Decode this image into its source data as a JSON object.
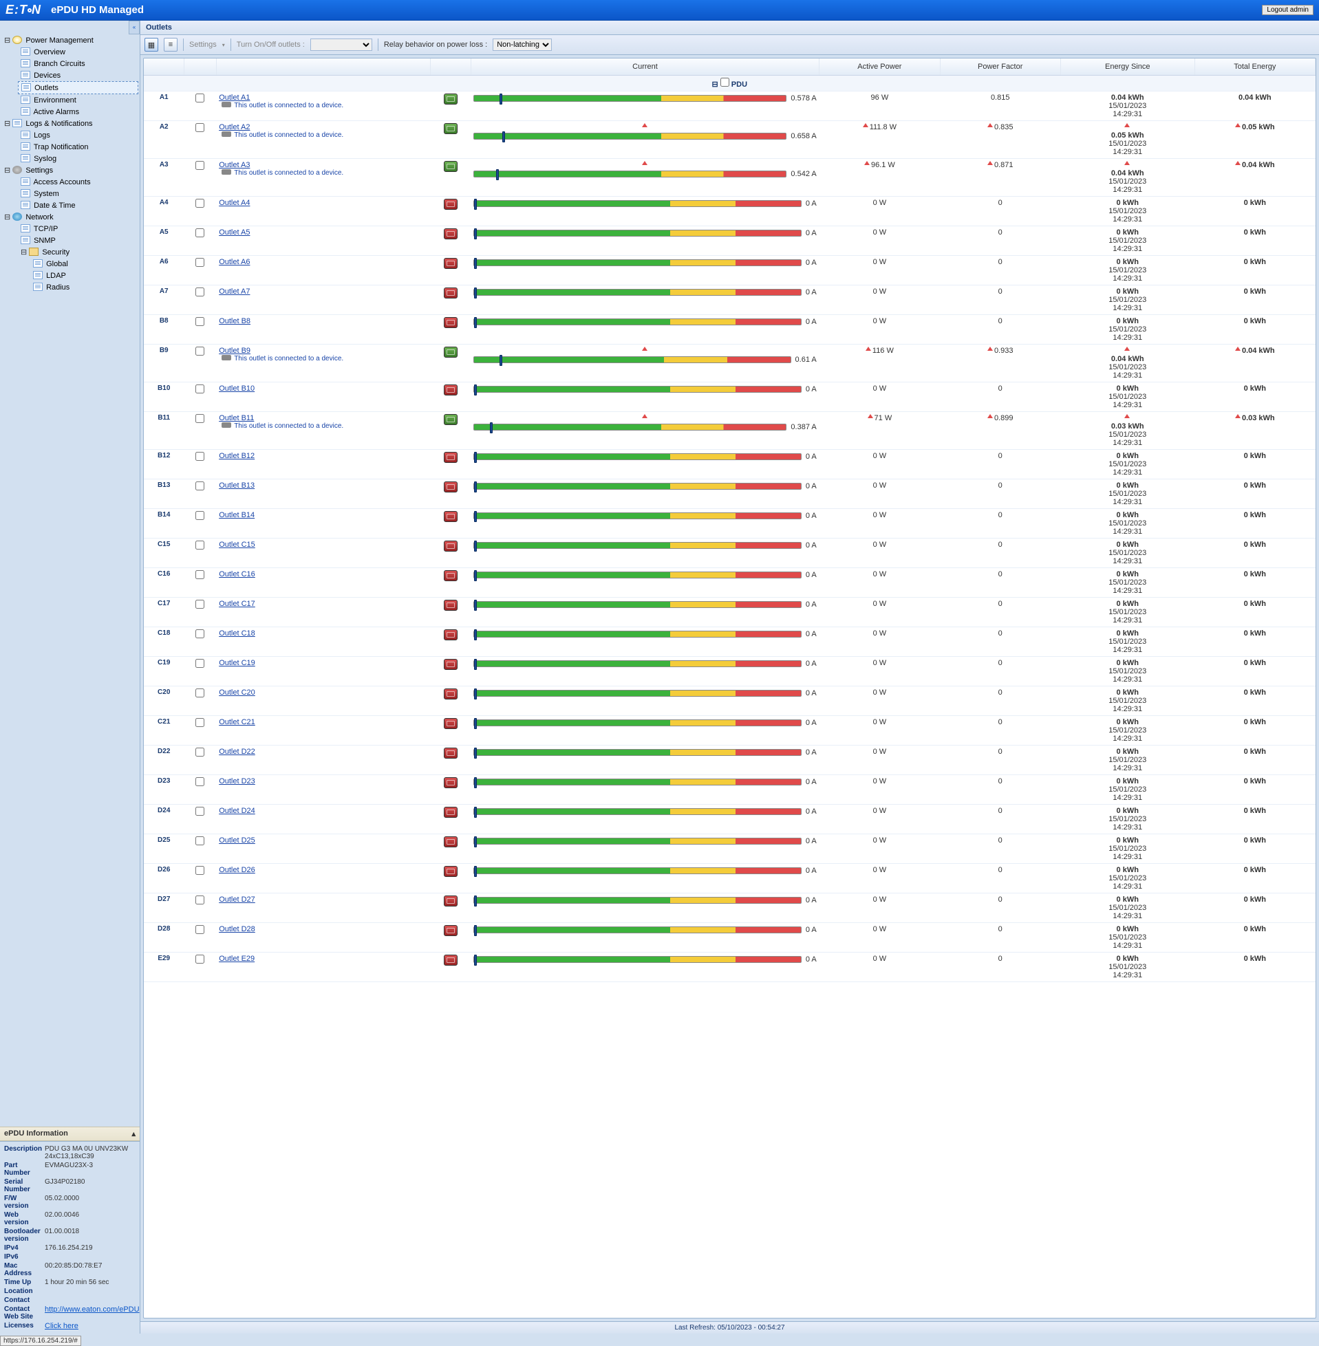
{
  "header": {
    "brand": "E•T•N",
    "product": "ePDU HD Managed",
    "logout": "Logout admin"
  },
  "nav": {
    "top": "Power Management",
    "items1": [
      "Overview",
      "Branch Circuits",
      "Devices",
      "Outlets",
      "Environment",
      "Active Alarms"
    ],
    "selected": "Outlets",
    "group2": "Logs & Notifications",
    "items2": [
      "Logs",
      "Trap Notification",
      "Syslog"
    ],
    "group3": "Settings",
    "items3": [
      "Access Accounts",
      "System",
      "Date & Time"
    ],
    "group4": "Network",
    "items4": [
      "TCP/IP",
      "SNMP"
    ],
    "sec": "Security",
    "items4b": [
      "Global",
      "LDAP",
      "Radius"
    ]
  },
  "meta": {
    "title": "ePDU Information",
    "rows": [
      [
        "Description",
        "PDU G3 MA 0U UNV23KW 24xC13,18xC39"
      ],
      [
        "Part Number",
        "EVMAGU23X-3"
      ],
      [
        "Serial Number",
        "GJ34P02180"
      ],
      [
        "F/W version",
        "05.02.0000"
      ],
      [
        "Web version",
        "02.00.0046"
      ],
      [
        "Bootloader version",
        "01.00.0018"
      ],
      [
        "IPv4",
        "176.16.254.219"
      ],
      [
        "IPv6",
        ""
      ],
      [
        "Mac Address",
        "00:20:85:D0:78:E7"
      ],
      [
        "Time Up",
        "1 hour 20 min 56 sec"
      ],
      [
        "Location",
        ""
      ],
      [
        "Contact",
        ""
      ]
    ],
    "website_lbl": "Contact Web Site",
    "website": "http://www.eaton.com/ePDU",
    "lic_lbl": "Licenses",
    "lic": "Click here"
  },
  "page": {
    "title": "Outlets"
  },
  "toolbar": {
    "settings": "Settings",
    "turn": "Turn On/Off outlets :",
    "relay": "Relay behavior on power loss :",
    "relay_val": "Non-latching"
  },
  "cols": {
    "c1": "",
    "c2": "",
    "c3": "",
    "c4": "",
    "cur": "Current",
    "ap": "Active Power",
    "pf": "Power Factor",
    "es": "Energy Since",
    "te": "Total Energy"
  },
  "group": "PDU",
  "conn_msg": "This outlet is connected to a device.",
  "ts": "15/01/2023 14:29:31",
  "outlets": [
    {
      "id": "A1",
      "name": "Outlet A1",
      "on": true,
      "conn": true,
      "pos": 8,
      "cur": "0.578 A",
      "ap": "96 W",
      "pf": "0.815",
      "es": "0.04 kWh",
      "te": "0.04 kWh",
      "tri": false
    },
    {
      "id": "A2",
      "name": "Outlet A2",
      "on": true,
      "conn": true,
      "pos": 9,
      "cur": "0.658 A",
      "ap": "111.8 W",
      "pf": "0.835",
      "es": "0.05 kWh",
      "te": "0.05 kWh",
      "tri": true
    },
    {
      "id": "A3",
      "name": "Outlet A3",
      "on": true,
      "conn": true,
      "pos": 7,
      "cur": "0.542 A",
      "ap": "96.1 W",
      "pf": "0.871",
      "es": "0.04 kWh",
      "te": "0.04 kWh",
      "tri": true
    },
    {
      "id": "A4",
      "name": "Outlet A4",
      "on": false,
      "conn": false,
      "pos": 0,
      "cur": "0 A",
      "ap": "0 W",
      "pf": "0",
      "es": "0 kWh",
      "te": "0 kWh",
      "tri": false
    },
    {
      "id": "A5",
      "name": "Outlet A5",
      "on": false,
      "conn": false,
      "pos": 0,
      "cur": "0 A",
      "ap": "0 W",
      "pf": "0",
      "es": "0 kWh",
      "te": "0 kWh",
      "tri": false
    },
    {
      "id": "A6",
      "name": "Outlet A6",
      "on": false,
      "conn": false,
      "pos": 0,
      "cur": "0 A",
      "ap": "0 W",
      "pf": "0",
      "es": "0 kWh",
      "te": "0 kWh",
      "tri": false
    },
    {
      "id": "A7",
      "name": "Outlet A7",
      "on": false,
      "conn": false,
      "pos": 0,
      "cur": "0 A",
      "ap": "0 W",
      "pf": "0",
      "es": "0 kWh",
      "te": "0 kWh",
      "tri": false
    },
    {
      "id": "B8",
      "name": "Outlet B8",
      "on": false,
      "conn": false,
      "pos": 0,
      "cur": "0 A",
      "ap": "0 W",
      "pf": "0",
      "es": "0 kWh",
      "te": "0 kWh",
      "tri": false
    },
    {
      "id": "B9",
      "name": "Outlet B9",
      "on": true,
      "conn": true,
      "pos": 8,
      "cur": "0.61 A",
      "ap": "116 W",
      "pf": "0.933",
      "es": "0.04 kWh",
      "te": "0.04 kWh",
      "tri": true
    },
    {
      "id": "B10",
      "name": "Outlet B10",
      "on": false,
      "conn": false,
      "pos": 0,
      "cur": "0 A",
      "ap": "0 W",
      "pf": "0",
      "es": "0 kWh",
      "te": "0 kWh",
      "tri": false
    },
    {
      "id": "B11",
      "name": "Outlet B11",
      "on": true,
      "conn": true,
      "pos": 5,
      "cur": "0.387 A",
      "ap": "71 W",
      "pf": "0.899",
      "es": "0.03 kWh",
      "te": "0.03 kWh",
      "tri": true
    },
    {
      "id": "B12",
      "name": "Outlet B12",
      "on": false,
      "conn": false,
      "pos": 0,
      "cur": "0 A",
      "ap": "0 W",
      "pf": "0",
      "es": "0 kWh",
      "te": "0 kWh",
      "tri": false
    },
    {
      "id": "B13",
      "name": "Outlet B13",
      "on": false,
      "conn": false,
      "pos": 0,
      "cur": "0 A",
      "ap": "0 W",
      "pf": "0",
      "es": "0 kWh",
      "te": "0 kWh",
      "tri": false
    },
    {
      "id": "B14",
      "name": "Outlet B14",
      "on": false,
      "conn": false,
      "pos": 0,
      "cur": "0 A",
      "ap": "0 W",
      "pf": "0",
      "es": "0 kWh",
      "te": "0 kWh",
      "tri": false
    },
    {
      "id": "C15",
      "name": "Outlet C15",
      "on": false,
      "conn": false,
      "pos": 0,
      "cur": "0 A",
      "ap": "0 W",
      "pf": "0",
      "es": "0 kWh",
      "te": "0 kWh",
      "tri": false
    },
    {
      "id": "C16",
      "name": "Outlet C16",
      "on": false,
      "conn": false,
      "pos": 0,
      "cur": "0 A",
      "ap": "0 W",
      "pf": "0",
      "es": "0 kWh",
      "te": "0 kWh",
      "tri": false
    },
    {
      "id": "C17",
      "name": "Outlet C17",
      "on": false,
      "conn": false,
      "pos": 0,
      "cur": "0 A",
      "ap": "0 W",
      "pf": "0",
      "es": "0 kWh",
      "te": "0 kWh",
      "tri": false
    },
    {
      "id": "C18",
      "name": "Outlet C18",
      "on": false,
      "conn": false,
      "pos": 0,
      "cur": "0 A",
      "ap": "0 W",
      "pf": "0",
      "es": "0 kWh",
      "te": "0 kWh",
      "tri": false
    },
    {
      "id": "C19",
      "name": "Outlet C19",
      "on": false,
      "conn": false,
      "pos": 0,
      "cur": "0 A",
      "ap": "0 W",
      "pf": "0",
      "es": "0 kWh",
      "te": "0 kWh",
      "tri": false
    },
    {
      "id": "C20",
      "name": "Outlet C20",
      "on": false,
      "conn": false,
      "pos": 0,
      "cur": "0 A",
      "ap": "0 W",
      "pf": "0",
      "es": "0 kWh",
      "te": "0 kWh",
      "tri": false
    },
    {
      "id": "C21",
      "name": "Outlet C21",
      "on": false,
      "conn": false,
      "pos": 0,
      "cur": "0 A",
      "ap": "0 W",
      "pf": "0",
      "es": "0 kWh",
      "te": "0 kWh",
      "tri": false
    },
    {
      "id": "D22",
      "name": "Outlet D22",
      "on": false,
      "conn": false,
      "pos": 0,
      "cur": "0 A",
      "ap": "0 W",
      "pf": "0",
      "es": "0 kWh",
      "te": "0 kWh",
      "tri": false
    },
    {
      "id": "D23",
      "name": "Outlet D23",
      "on": false,
      "conn": false,
      "pos": 0,
      "cur": "0 A",
      "ap": "0 W",
      "pf": "0",
      "es": "0 kWh",
      "te": "0 kWh",
      "tri": false
    },
    {
      "id": "D24",
      "name": "Outlet D24",
      "on": false,
      "conn": false,
      "pos": 0,
      "cur": "0 A",
      "ap": "0 W",
      "pf": "0",
      "es": "0 kWh",
      "te": "0 kWh",
      "tri": false
    },
    {
      "id": "D25",
      "name": "Outlet D25",
      "on": false,
      "conn": false,
      "pos": 0,
      "cur": "0 A",
      "ap": "0 W",
      "pf": "0",
      "es": "0 kWh",
      "te": "0 kWh",
      "tri": false
    },
    {
      "id": "D26",
      "name": "Outlet D26",
      "on": false,
      "conn": false,
      "pos": 0,
      "cur": "0 A",
      "ap": "0 W",
      "pf": "0",
      "es": "0 kWh",
      "te": "0 kWh",
      "tri": false
    },
    {
      "id": "D27",
      "name": "Outlet D27",
      "on": false,
      "conn": false,
      "pos": 0,
      "cur": "0 A",
      "ap": "0 W",
      "pf": "0",
      "es": "0 kWh",
      "te": "0 kWh",
      "tri": false
    },
    {
      "id": "D28",
      "name": "Outlet D28",
      "on": false,
      "conn": false,
      "pos": 0,
      "cur": "0 A",
      "ap": "0 W",
      "pf": "0",
      "es": "0 kWh",
      "te": "0 kWh",
      "tri": false
    },
    {
      "id": "E29",
      "name": "Outlet E29",
      "on": false,
      "conn": false,
      "pos": 0,
      "cur": "0 A",
      "ap": "0 W",
      "pf": "0",
      "es": "0 kWh",
      "te": "0 kWh",
      "tri": false
    }
  ],
  "footer": "Last Refresh: 05/10/2023 - 00:54:27",
  "status": "https://176.16.254.219/#"
}
